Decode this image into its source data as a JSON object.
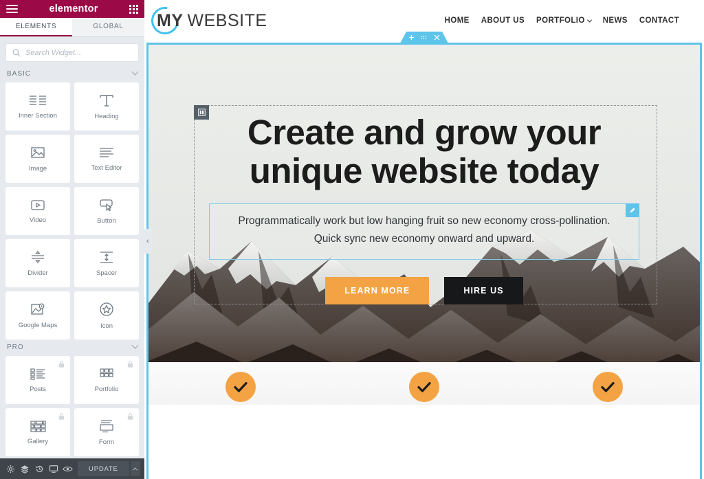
{
  "panel": {
    "brand": "elementor",
    "menu_icon": "hamburger-icon",
    "apps_icon": "apps-grid-icon",
    "tabs": [
      {
        "label": "ELEMENTS",
        "active": true
      },
      {
        "label": "GLOBAL",
        "active": false
      }
    ],
    "search": {
      "placeholder": "Search Widget...",
      "value": "",
      "icon": "search-icon"
    },
    "categories": [
      {
        "label": "BASIC",
        "expanded": true
      },
      {
        "label": "PRO",
        "expanded": true
      }
    ],
    "basic_widgets": [
      {
        "label": "Inner Section",
        "icon": "columns-icon",
        "locked": false
      },
      {
        "label": "Heading",
        "icon": "heading-t-icon",
        "locked": false
      },
      {
        "label": "Image",
        "icon": "image-icon",
        "locked": false
      },
      {
        "label": "Text Editor",
        "icon": "text-lines-icon",
        "locked": false
      },
      {
        "label": "Video",
        "icon": "video-play-icon",
        "locked": false
      },
      {
        "label": "Button",
        "icon": "button-cursor-icon",
        "locked": false
      },
      {
        "label": "Divider",
        "icon": "divider-icon",
        "locked": false
      },
      {
        "label": "Spacer",
        "icon": "spacer-arrows-icon",
        "locked": false
      },
      {
        "label": "Google Maps",
        "icon": "map-pin-icon",
        "locked": false
      },
      {
        "label": "Icon",
        "icon": "star-circle-icon",
        "locked": false
      }
    ],
    "pro_widgets": [
      {
        "label": "Posts",
        "icon": "posts-list-icon",
        "locked": true
      },
      {
        "label": "Portfolio",
        "icon": "portfolio-grid-icon",
        "locked": true
      },
      {
        "label": "Gallery",
        "icon": "gallery-icon",
        "locked": true
      },
      {
        "label": "Form",
        "icon": "form-icon",
        "locked": true
      }
    ],
    "footer": {
      "tools": [
        {
          "name": "settings-gear-icon"
        },
        {
          "name": "navigator-layers-icon"
        },
        {
          "name": "history-icon"
        },
        {
          "name": "responsive-mode-icon"
        },
        {
          "name": "preview-eye-icon"
        }
      ],
      "update_label": "UPDATE",
      "caret_icon": "caret-up-icon"
    },
    "collapse_icon": "collapse-panel-arrow-icon"
  },
  "site": {
    "logo": {
      "first": "MY",
      "second": "WEBSITE",
      "arc_color": "#3fc3ee"
    },
    "nav": [
      {
        "label": "HOME",
        "has_chevron": false
      },
      {
        "label": "ABOUT US",
        "has_chevron": false
      },
      {
        "label": "PORTFOLIO",
        "has_chevron": true
      },
      {
        "label": "NEWS",
        "has_chevron": false
      },
      {
        "label": "CONTACT",
        "has_chevron": false
      }
    ]
  },
  "editor": {
    "section_handle": {
      "add_icon": "plus-icon",
      "drag_icon": "drag-dots-icon",
      "close_icon": "close-x-icon",
      "accent": "#5ec4ea"
    },
    "column_handle_icon": "column-handle-icon",
    "edit_badge_icon": "pencil-edit-icon"
  },
  "hero": {
    "title_line1": "Create and grow your",
    "title_line2": "unique website today",
    "text_line1": "Programmatically work but low hanging fruit so new economy cross-pollination.",
    "text_line2": "Quick sync new economy onward and upward.",
    "buttons": [
      {
        "label": "LEARN MORE",
        "style": "primary",
        "color": "#f4a344"
      },
      {
        "label": "HIRE US",
        "style": "dark",
        "color": "#17181a"
      }
    ]
  },
  "features": [
    {
      "icon": "check-icon"
    },
    {
      "icon": "check-icon"
    },
    {
      "icon": "check-icon"
    }
  ]
}
